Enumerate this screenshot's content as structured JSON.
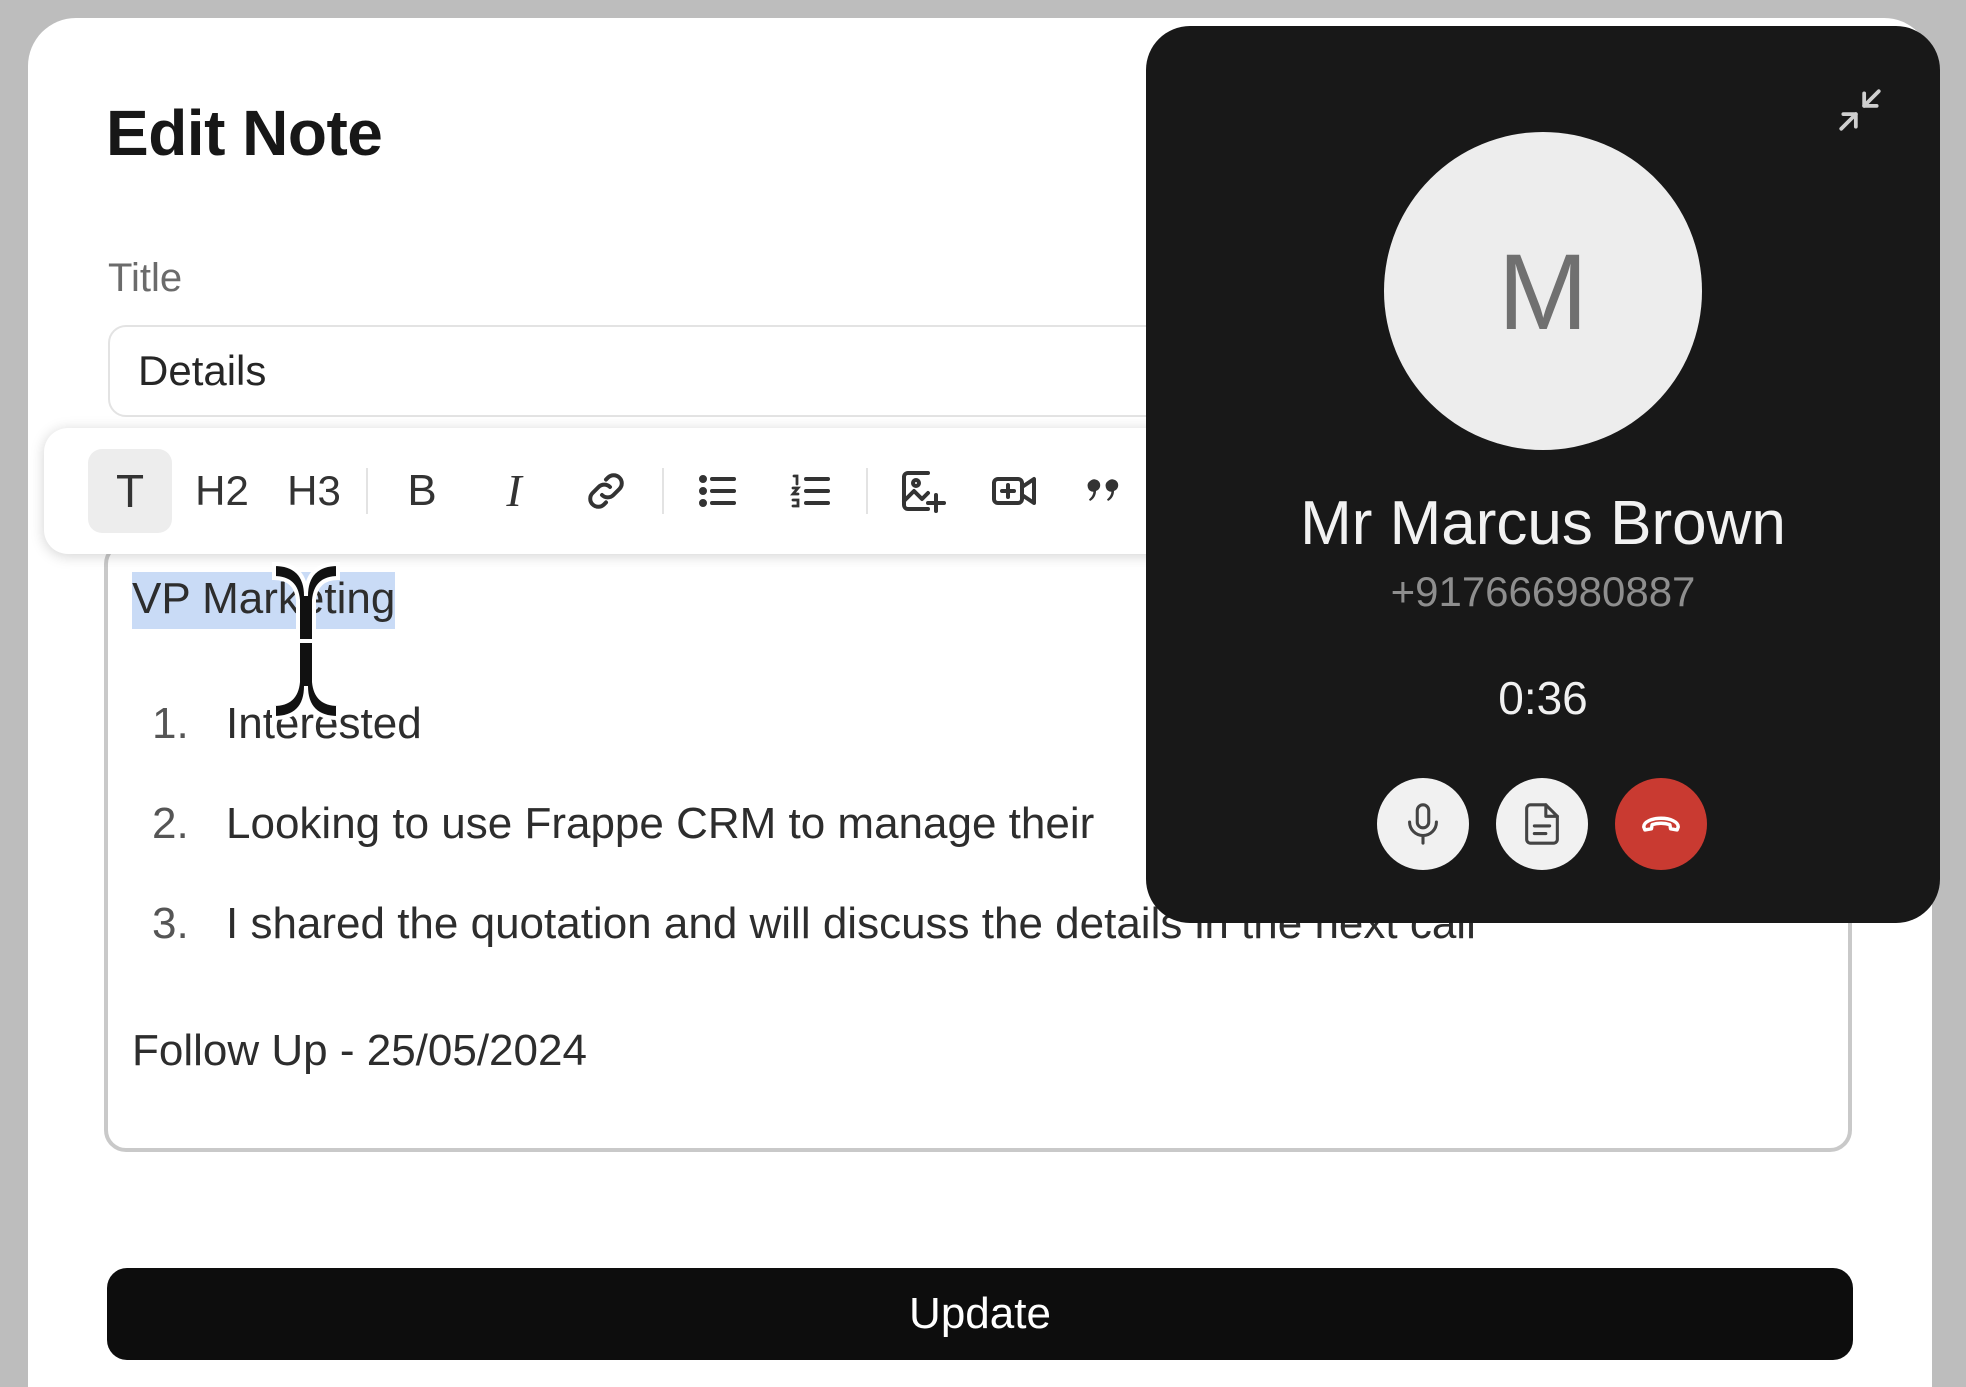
{
  "modal": {
    "title": "Edit Note",
    "title_field_label": "Title",
    "title_value": "Details",
    "update_label": "Update"
  },
  "toolbar": {
    "paragraph": "T",
    "heading2": "H2",
    "heading3": "H3",
    "bold": "B",
    "italic": "I",
    "icons": [
      "link-icon",
      "bullet-list-icon",
      "numbered-list-icon",
      "image-add-icon",
      "video-add-icon",
      "quote-icon"
    ]
  },
  "editor": {
    "selected_line": "VP Marketing",
    "list_numbers": [
      "1.",
      "2.",
      "3."
    ],
    "list_items": [
      "Interested",
      "Looking to use Frappe CRM to manage their",
      "I shared the quotation and will discuss the details in the next call"
    ],
    "follow_up": "Follow Up - 25/05/2024"
  },
  "call": {
    "avatar_initial": "M",
    "caller_name": "Mr Marcus Brown",
    "caller_phone": "+917666980887",
    "timer": "0:36",
    "end_call_color": "#c93a31"
  }
}
